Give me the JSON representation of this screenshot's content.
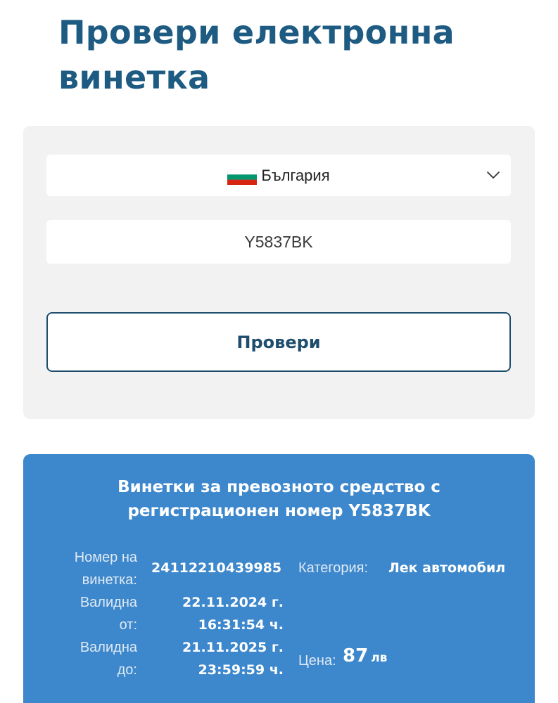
{
  "page": {
    "title": "Провери електронна винетка"
  },
  "form": {
    "country": {
      "label": "България",
      "flag": "bulgaria-flag-icon",
      "flag_colors": [
        "#ffffff",
        "#00966e",
        "#d62612"
      ]
    },
    "plate_input": {
      "value": "Y5837BK"
    },
    "check_button": {
      "label": "Провери"
    }
  },
  "result": {
    "title": "Винетки за превозното средство с регистрационен номер Y5837BK",
    "vignette_number": {
      "label_line1": "Номер на",
      "label_line2": "винетка:",
      "value": "24112210439985"
    },
    "valid_from": {
      "label_line1": "Валидна",
      "label_line2": "от:",
      "date": "22.11.2024 г.",
      "time": "16:31:54 ч."
    },
    "valid_to": {
      "label_line1": "Валидна",
      "label_line2": "до:",
      "date": "21.11.2025 г.",
      "time": "23:59:59 ч."
    },
    "category": {
      "label": "Категория:",
      "value": "Лек автомобил"
    },
    "price": {
      "label": "Цена:",
      "amount": "87",
      "currency": "лв"
    }
  },
  "colors": {
    "title": "#1e5b82",
    "panel_bg": "#f2f2f2",
    "button_border": "#1e4d6e",
    "result_bg": "#3d88cc"
  }
}
